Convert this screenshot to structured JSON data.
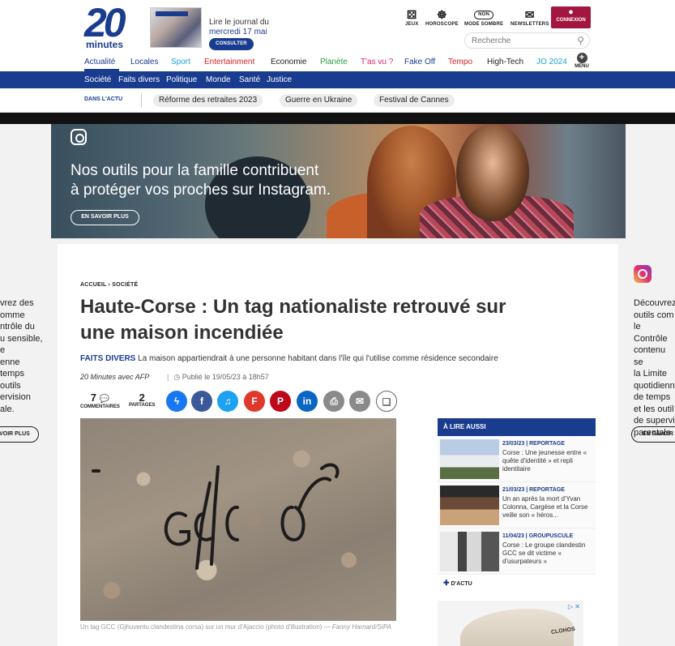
{
  "brand": {
    "digits": "20",
    "word": "minutes"
  },
  "journal": {
    "line1": "Lire le journal du",
    "date": "mercredi 17 mai",
    "button": "CONSULTER"
  },
  "tools": {
    "jeux": "JEUX",
    "horoscope": "HOROSCOPE",
    "mode_toggle": "NON",
    "mode_sombre": "MODE SOMBRE",
    "newsletters": "NEWSLETTERS",
    "connexion": "CONNEXION"
  },
  "search": {
    "placeholder": "Recherche"
  },
  "mainnav": [
    {
      "label": "Actualité",
      "color": "#1a3c8f"
    },
    {
      "label": "Locales",
      "color": "#1a3c8f"
    },
    {
      "label": "Sport",
      "color": "#1aa3d6"
    },
    {
      "label": "Entertainment",
      "color": "#d41d24"
    },
    {
      "label": "Economie",
      "color": "#222222"
    },
    {
      "label": "Planète",
      "color": "#2a9d3a"
    },
    {
      "label": "T'as vu ?",
      "color": "#e01f74"
    },
    {
      "label": "Fake Off",
      "color": "#1a3c8f"
    },
    {
      "label": "Tempo",
      "color": "#d41d24"
    },
    {
      "label": "High-Tech",
      "color": "#222222"
    },
    {
      "label": "JO 2024",
      "color": "#1aa3d6"
    }
  ],
  "menu_label": "MENU",
  "subnav": [
    "Société",
    "Faits divers",
    "Politique",
    "Monde",
    "Santé",
    "Justice"
  ],
  "actu": {
    "label": "DANS L'ACTU",
    "pills": [
      "Réforme des retraites 2023",
      "Guerre en Ukraine",
      "Festival de Cannes"
    ]
  },
  "banner": {
    "line1": "Nos outils pour la famille contribuent",
    "line2": "à protéger vos proches sur Instagram.",
    "button": "EN SAVOIR PLUS"
  },
  "left_ad": {
    "lines": [
      "vrez des",
      "omme",
      "ntrôle du",
      "u sensible,",
      "e",
      "enne",
      "temps",
      "outils",
      "ervision",
      "ale."
    ],
    "button": "VOIR PLUS"
  },
  "right_ad": {
    "lines": [
      "Découvrez",
      "outils com",
      "le Contrôle",
      "contenu se",
      "la Limite",
      "quotidienn",
      "de temps",
      "et les outil",
      "de supervi",
      "parentale."
    ],
    "button": "EN SAVOIR"
  },
  "article": {
    "breadcrumb": "ACCUEIL › SOCIÉTÉ",
    "title": "Haute-Corse : Un tag nationaliste retrouvé sur une maison incendiée",
    "rubrique": "FAITS DIVERS",
    "chapo": "La maison appartiendrait à une personne habitant dans l'île qui l'utilise comme résidence secondaire",
    "author": "20 Minutes avec AFP",
    "published": "Publié le 19/05/23 à 18h57",
    "comments_count": "7",
    "comments_label": "COMMENTAIRES",
    "shares_count": "2",
    "shares_label": "PARTAGES",
    "caption_main": "Un tag GCC (Gjhuventu clandestina corsa) sur un mur d'Ajaccio (photo d'illustration) —",
    "caption_credit": "Fanny Harnard/SIPA"
  },
  "aside": {
    "header": "À LIRE AUSSI",
    "items": [
      {
        "tag": "23/03/23 | REPORTAGE",
        "text": "Corse : Une jeunesse entre « quête d'identité » et repli identitaire"
      },
      {
        "tag": "21/03/23 | REPORTAGE",
        "text": "Un an après la mort d'Yvan Colonna, Cargèse et la Corse veille son « héros..."
      },
      {
        "tag": "11/04/23 | GROUPUSCULE",
        "text": "Corse : Le groupe clandestin GCC se dit victime « d'usurpateurs »"
      }
    ],
    "plus": "D'ACTU"
  },
  "ad_brand": "CLOHOS"
}
